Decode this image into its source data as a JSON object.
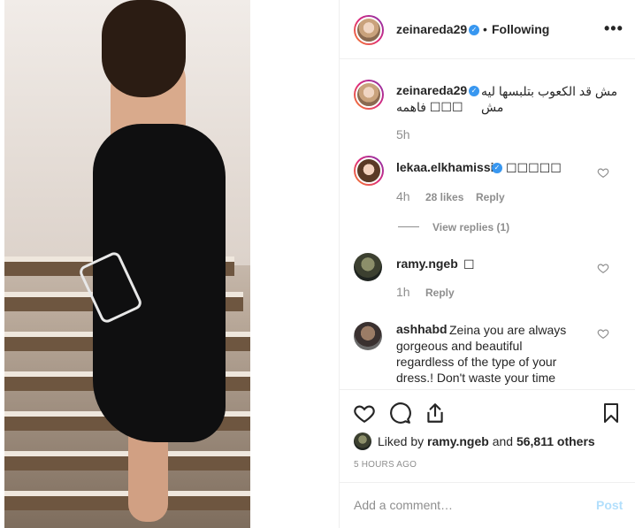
{
  "post": {
    "author": "zeinareda29",
    "follow_label": "Following",
    "separator": "•",
    "more_label": "•••"
  },
  "caption": {
    "username": "zeinareda29",
    "text_line1": "مش قد الكعوب بتلبسها ليه مش",
    "text_line2": "فاهمه ☐☐☐",
    "time": "5h"
  },
  "comments": [
    {
      "username": "lekaa.elkhamissi",
      "text": "☐☐☐☐☐",
      "time": "4h",
      "likes": "28 likes",
      "reply": "Reply",
      "view_replies": "View replies (1)"
    },
    {
      "username": "ramy.ngeb",
      "text": "☐",
      "time": "1h",
      "reply": "Reply"
    },
    {
      "username": "ashhabd",
      "text_line1": "Zeina you are always",
      "text_line2": "gorgeous and beautiful",
      "text_line3": "regardless of the type of your",
      "text_line4": "dress.! Don't waste your time"
    }
  ],
  "likes": {
    "prefix": "Liked by",
    "user": "ramy.ngeb",
    "middle": "and",
    "count": "56,811 others"
  },
  "time_ago": "5 HOURS AGO",
  "comment_input": {
    "placeholder": "Add a comment…",
    "post_label": "Post"
  },
  "icons": {
    "heart": "heart-icon",
    "comment": "comment-icon",
    "share": "share-icon",
    "save": "bookmark-icon",
    "more": "more-icon",
    "verified": "verified-badge-icon"
  },
  "colors": {
    "verified": "#3897f0",
    "muted": "#8e8e8e",
    "post_disabled": "#b2dffc",
    "text": "#262626"
  }
}
